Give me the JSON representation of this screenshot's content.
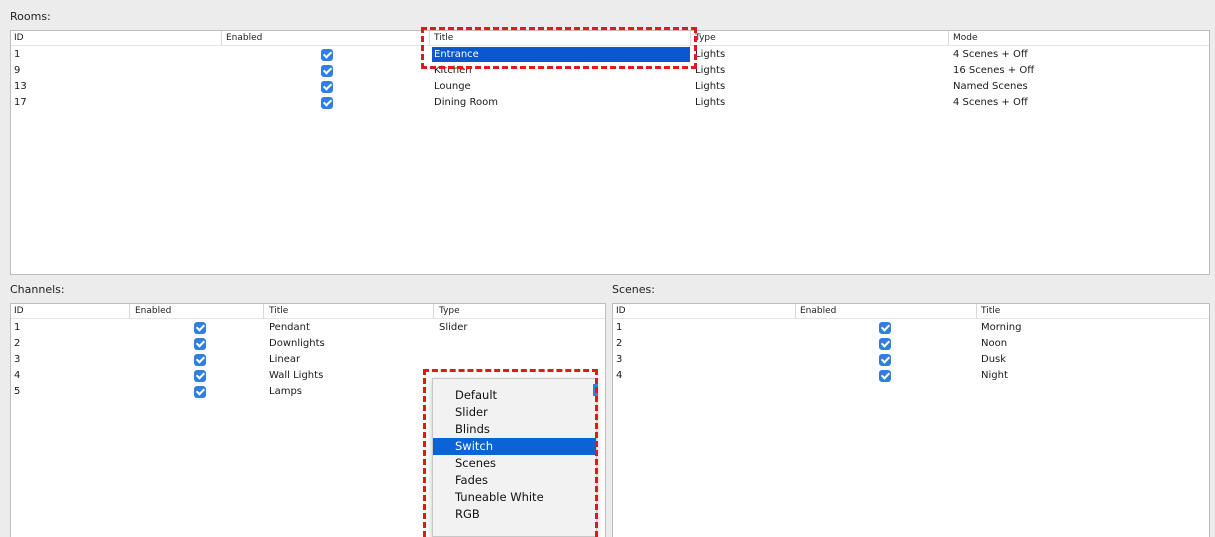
{
  "rooms": {
    "label": "Rooms:",
    "columns": [
      "ID",
      "Enabled",
      "Title",
      "Type",
      "Mode"
    ],
    "rows": [
      {
        "id": "1",
        "title": "Entrance",
        "type": "Lights",
        "mode": "4 Scenes + Off"
      },
      {
        "id": "9",
        "title": "Kitchen",
        "type": "Lights",
        "mode": "16 Scenes + Off"
      },
      {
        "id": "13",
        "title": "Lounge",
        "type": "Lights",
        "mode": "Named Scenes"
      },
      {
        "id": "17",
        "title": "Dining Room",
        "type": "Lights",
        "mode": "4 Scenes + Off"
      }
    ]
  },
  "channels": {
    "label": "Channels:",
    "columns": [
      "ID",
      "Enabled",
      "Title",
      "Type"
    ],
    "rows": [
      {
        "id": "1",
        "title": "Pendant",
        "type": "Slider"
      },
      {
        "id": "2",
        "title": "Downlights",
        "type": ""
      },
      {
        "id": "3",
        "title": "Linear",
        "type": ""
      },
      {
        "id": "4",
        "title": "Wall Lights",
        "type": ""
      },
      {
        "id": "5",
        "title": "Lamps",
        "type": ""
      }
    ],
    "type_dropdown": {
      "options": [
        "Default",
        "Slider",
        "Blinds",
        "Switch",
        "Scenes",
        "Fades",
        "Tuneable White",
        "RGB"
      ],
      "highlighted": "Switch"
    }
  },
  "scenes": {
    "label": "Scenes:",
    "columns": [
      "ID",
      "Enabled",
      "Title"
    ],
    "rows": [
      {
        "id": "1",
        "title": "Morning"
      },
      {
        "id": "2",
        "title": "Noon"
      },
      {
        "id": "3",
        "title": "Dusk"
      },
      {
        "id": "4",
        "title": "Night"
      }
    ]
  },
  "colors": {
    "selection": "#0a58d0",
    "checkbox": "#2f7fe0",
    "highlight_box": "#e01a1a"
  }
}
